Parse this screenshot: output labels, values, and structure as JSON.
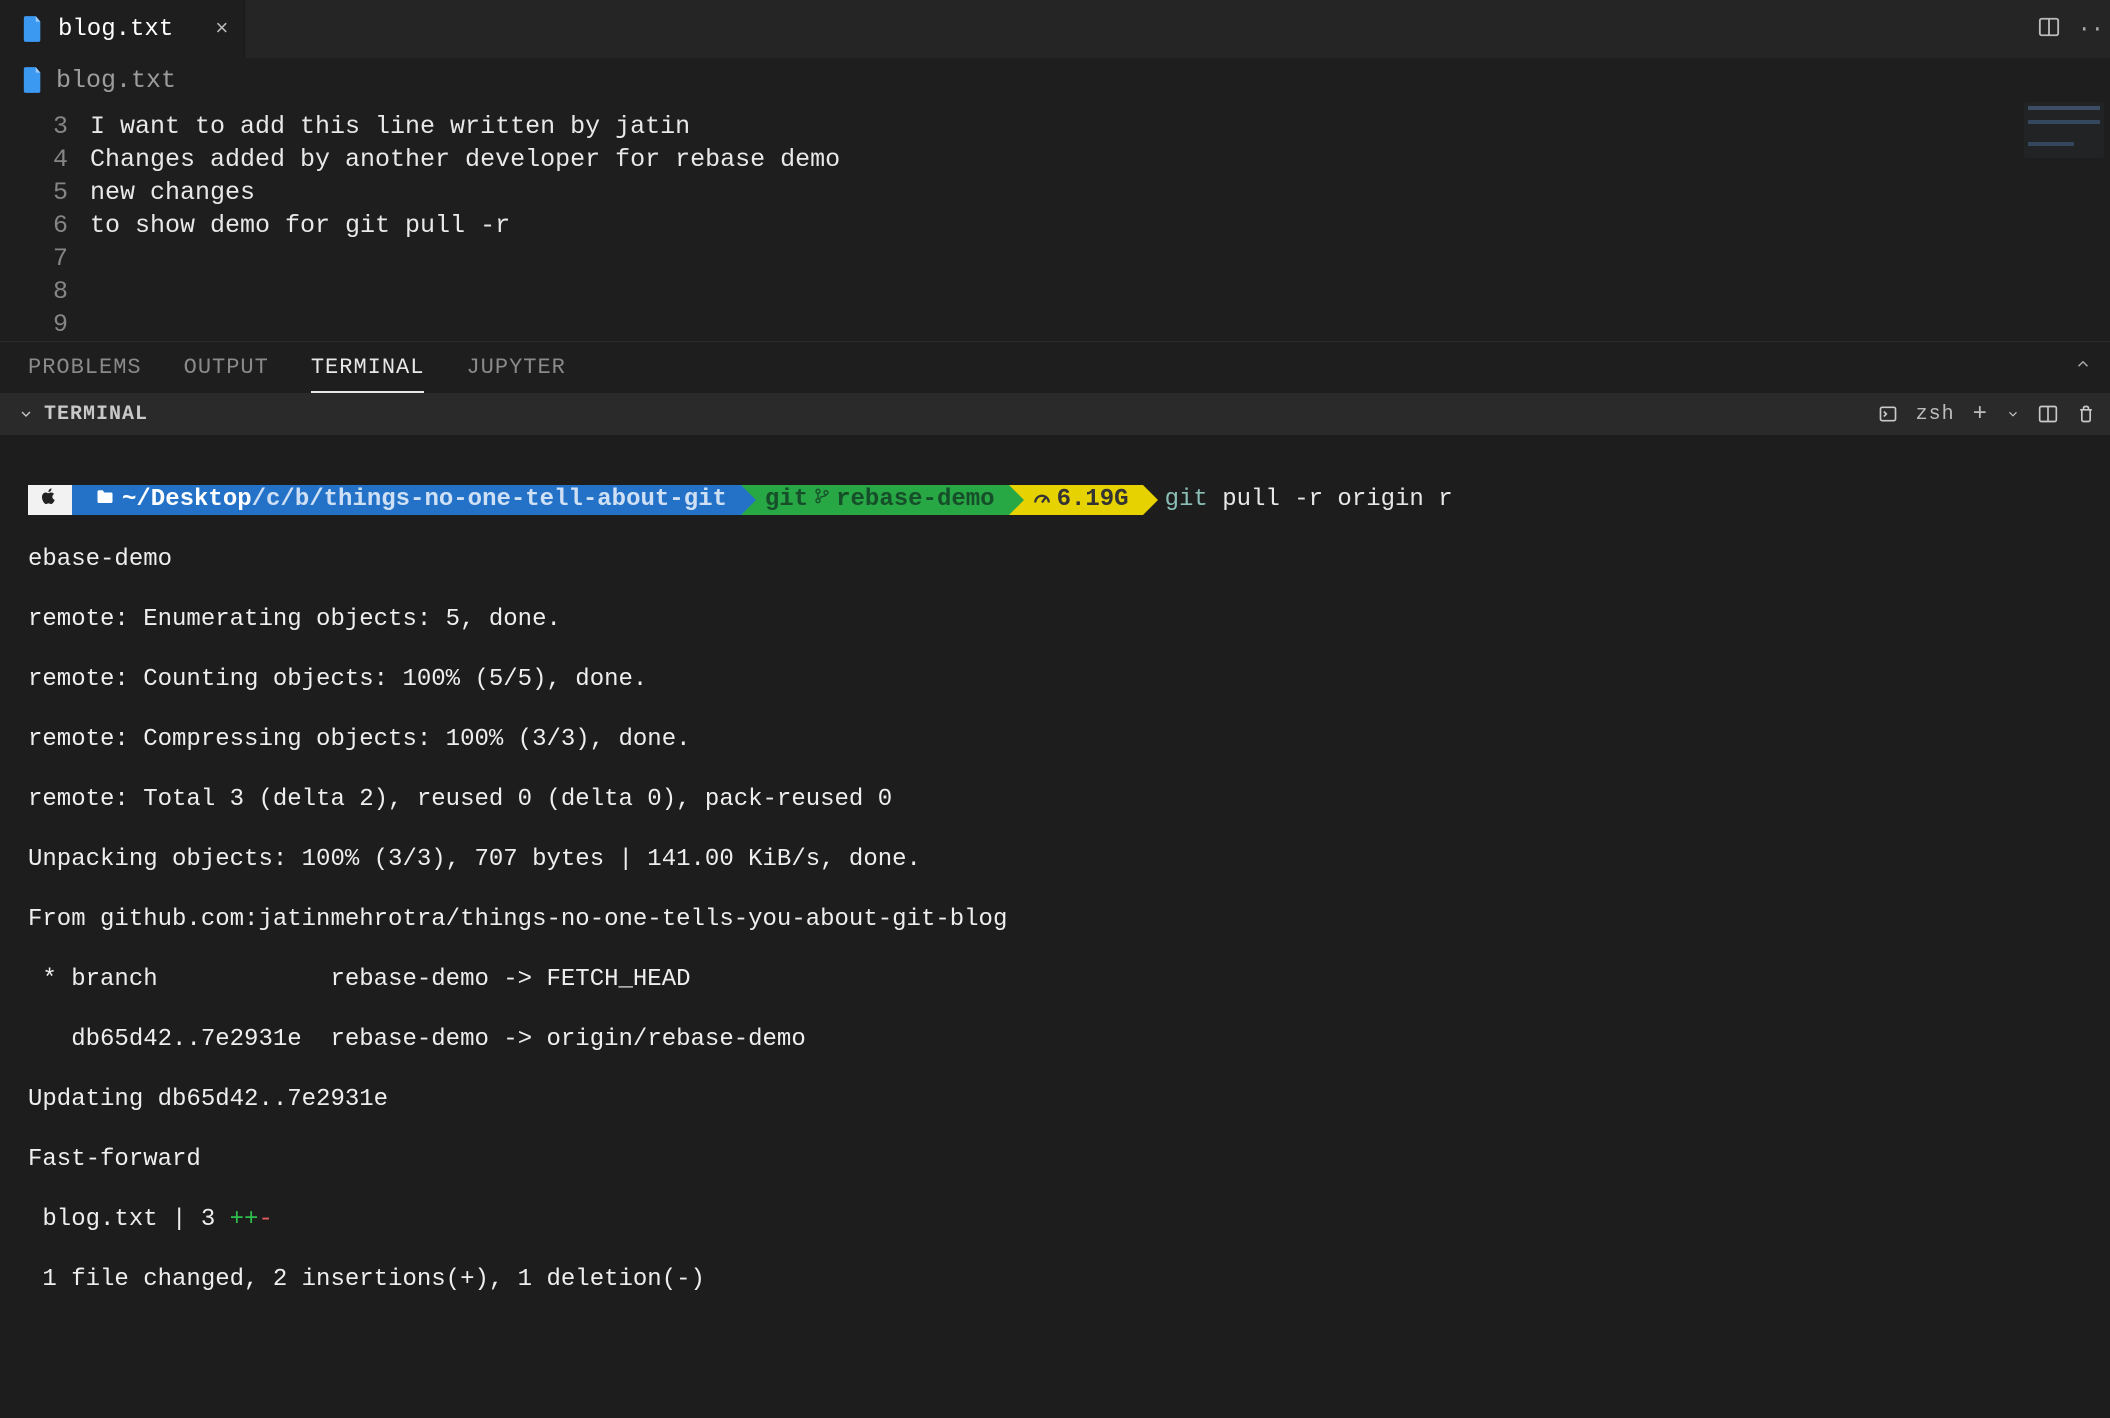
{
  "tab": {
    "filename": "blog.txt",
    "close_glyph": "×"
  },
  "breadcrumb": {
    "filename": "blog.txt"
  },
  "editor": {
    "lines": [
      {
        "num": "3",
        "text": "I want to add this line written by jatin"
      },
      {
        "num": "4",
        "text": ""
      },
      {
        "num": "5",
        "text": "Changes added by another developer for rebase demo"
      },
      {
        "num": "6",
        "text": ""
      },
      {
        "num": "7",
        "text": ""
      },
      {
        "num": "8",
        "text": "new changes"
      },
      {
        "num": "9",
        "text": "to show demo for git pull -r"
      }
    ]
  },
  "panel": {
    "tabs": {
      "problems": "PROBLEMS",
      "output": "OUTPUT",
      "terminal": "TERMINAL",
      "jupyter": "JUPYTER"
    }
  },
  "terminal_header": {
    "label": "TERMINAL",
    "shell": "zsh"
  },
  "prompt": {
    "path_home": "~/Desktop",
    "path_rest": "/c/b/things-no-one-tell-about-git",
    "git_label": "git",
    "branch": "rebase-demo",
    "disk": "6.19G",
    "cmd_git": "git",
    "cmd_rest": " pull -r origin r"
  },
  "terminal_output": {
    "l1": "ebase-demo",
    "l2": "remote: Enumerating objects: 5, done.",
    "l3": "remote: Counting objects: 100% (5/5), done.",
    "l4": "remote: Compressing objects: 100% (3/3), done.",
    "l5": "remote: Total 3 (delta 2), reused 0 (delta 0), pack-reused 0",
    "l6": "Unpacking objects: 100% (3/3), 707 bytes | 141.00 KiB/s, done.",
    "l7": "From github.com:jatinmehrotra/things-no-one-tells-you-about-git-blog",
    "l8": " * branch            rebase-demo -> FETCH_HEAD",
    "l9": "   db65d42..7e2931e  rebase-demo -> origin/rebase-demo",
    "l10": "Updating db65d42..7e2931e",
    "l11": "Fast-forward",
    "l12a": " blog.txt | 3 ",
    "l12b": "++",
    "l12c": "-",
    "l13": " 1 file changed, 2 insertions(+), 1 deletion(-)"
  }
}
